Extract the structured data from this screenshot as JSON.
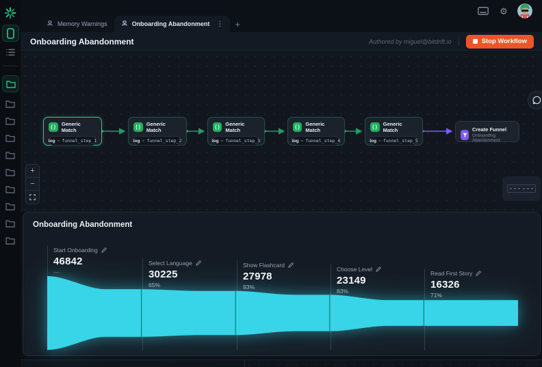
{
  "colors": {
    "accent_green": "#2fbf71",
    "funnel_cyan": "#38d4e8",
    "edge_purple": "#7a5af5",
    "stop_orange": "#ef5428"
  },
  "sidebar": {
    "icons": [
      "bitdrift-spark-logo",
      "device-icon",
      "list-icon",
      "folder-icon-active",
      "folder-icon"
    ]
  },
  "topbar": {
    "tabs": [
      {
        "label": "Memory Warnings",
        "active": false
      },
      {
        "label": "Onboarding Abandonment",
        "active": true
      }
    ],
    "tab_menu": "⋮",
    "new_tab_label": "+",
    "right_icons": [
      "keyboard-icon",
      "settings-gear-icon",
      "user-avatar"
    ]
  },
  "header": {
    "title": "Onboarding Abandonment",
    "authored_by": "Authored by miguel@bitdrift.io",
    "stop_button": "Stop Workflow"
  },
  "workflow": {
    "nodes": [
      {
        "title": "Generic Match",
        "field": "log",
        "op": "=",
        "value": "funnel_step_1"
      },
      {
        "title": "Generic Match",
        "field": "log",
        "op": "=",
        "value": "funnel_step_2"
      },
      {
        "title": "Generic Match",
        "field": "log",
        "op": "=",
        "value": "funnel_step_3"
      },
      {
        "title": "Generic Match",
        "field": "log",
        "op": "=",
        "value": "funnel_step_4"
      },
      {
        "title": "Generic Match",
        "field": "log",
        "op": "=",
        "value": "funnel_step_5"
      }
    ],
    "output": {
      "title": "Create Funnel",
      "subtitle": "Onboarding Abandonment"
    },
    "zoom_controls": {
      "zoom_in": "+",
      "zoom_out": "−"
    }
  },
  "funnel_panel": {
    "title": "Onboarding Abandonment"
  },
  "chart_data": {
    "type": "funnel",
    "title": "Onboarding Abandonment",
    "categories": [
      "Start Onboarding",
      "Select Language",
      "Show Flashcard",
      "Choose Level",
      "Read First Story"
    ],
    "values": [
      46842,
      30225,
      27978,
      23149,
      16326
    ],
    "conversion_from_prev": [
      "—",
      "65%",
      "93%",
      "83%",
      "71%"
    ],
    "color": "#38d4e8",
    "orientation": "horizontal-area",
    "legend": "none",
    "grid": "segment-dividers"
  }
}
